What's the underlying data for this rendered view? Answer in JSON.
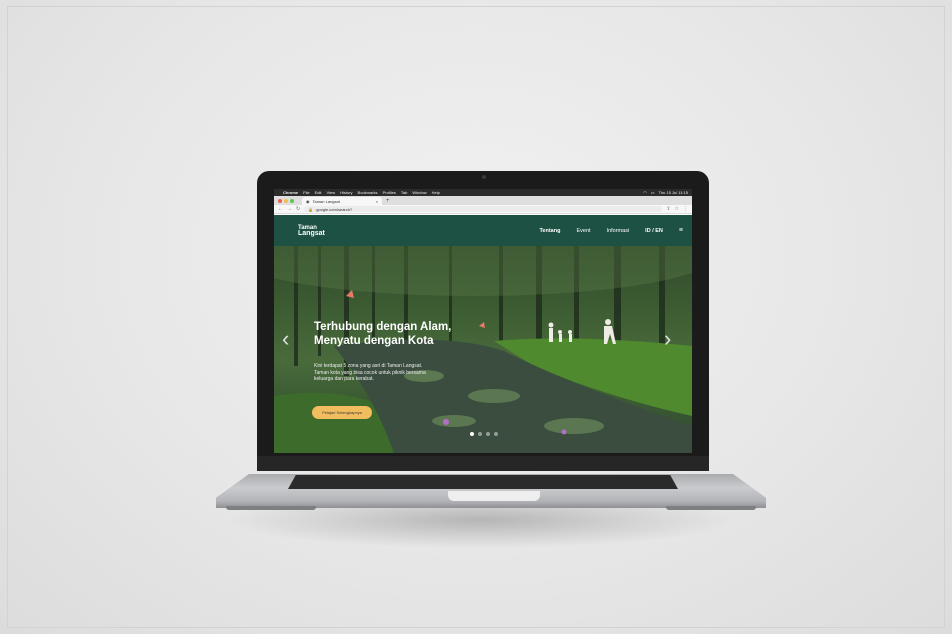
{
  "macos_menubar": {
    "app": "Chrome",
    "items": [
      "File",
      "Edit",
      "View",
      "History",
      "Bookmarks",
      "Profiles",
      "Tab",
      "Window",
      "Help"
    ],
    "clock": "Thu 15 Jul 11:15"
  },
  "browser": {
    "tab_title": "Taman Langsat",
    "url": "google.com/search?"
  },
  "site": {
    "logo_line1": "Taman",
    "logo_line2": "Langsat",
    "nav": [
      "Tentang",
      "Event",
      "Informasi"
    ],
    "language": "ID / EN"
  },
  "hero": {
    "title_line1": "Terhubung dengan Alam,",
    "title_line2": "Menyatu dengan Kota",
    "body": "Kini terdapat 5 zona yang asri di Taman Langsat. Taman kota yang bisa cocok untuk piknik bersama keluarga dan para kerabat.",
    "cta": "Pelajari Selengkapnya",
    "slide_count": 4,
    "active_slide": 1
  },
  "colors": {
    "header_green": "#1d5144",
    "cta_yellow": "#f1bd5e"
  }
}
